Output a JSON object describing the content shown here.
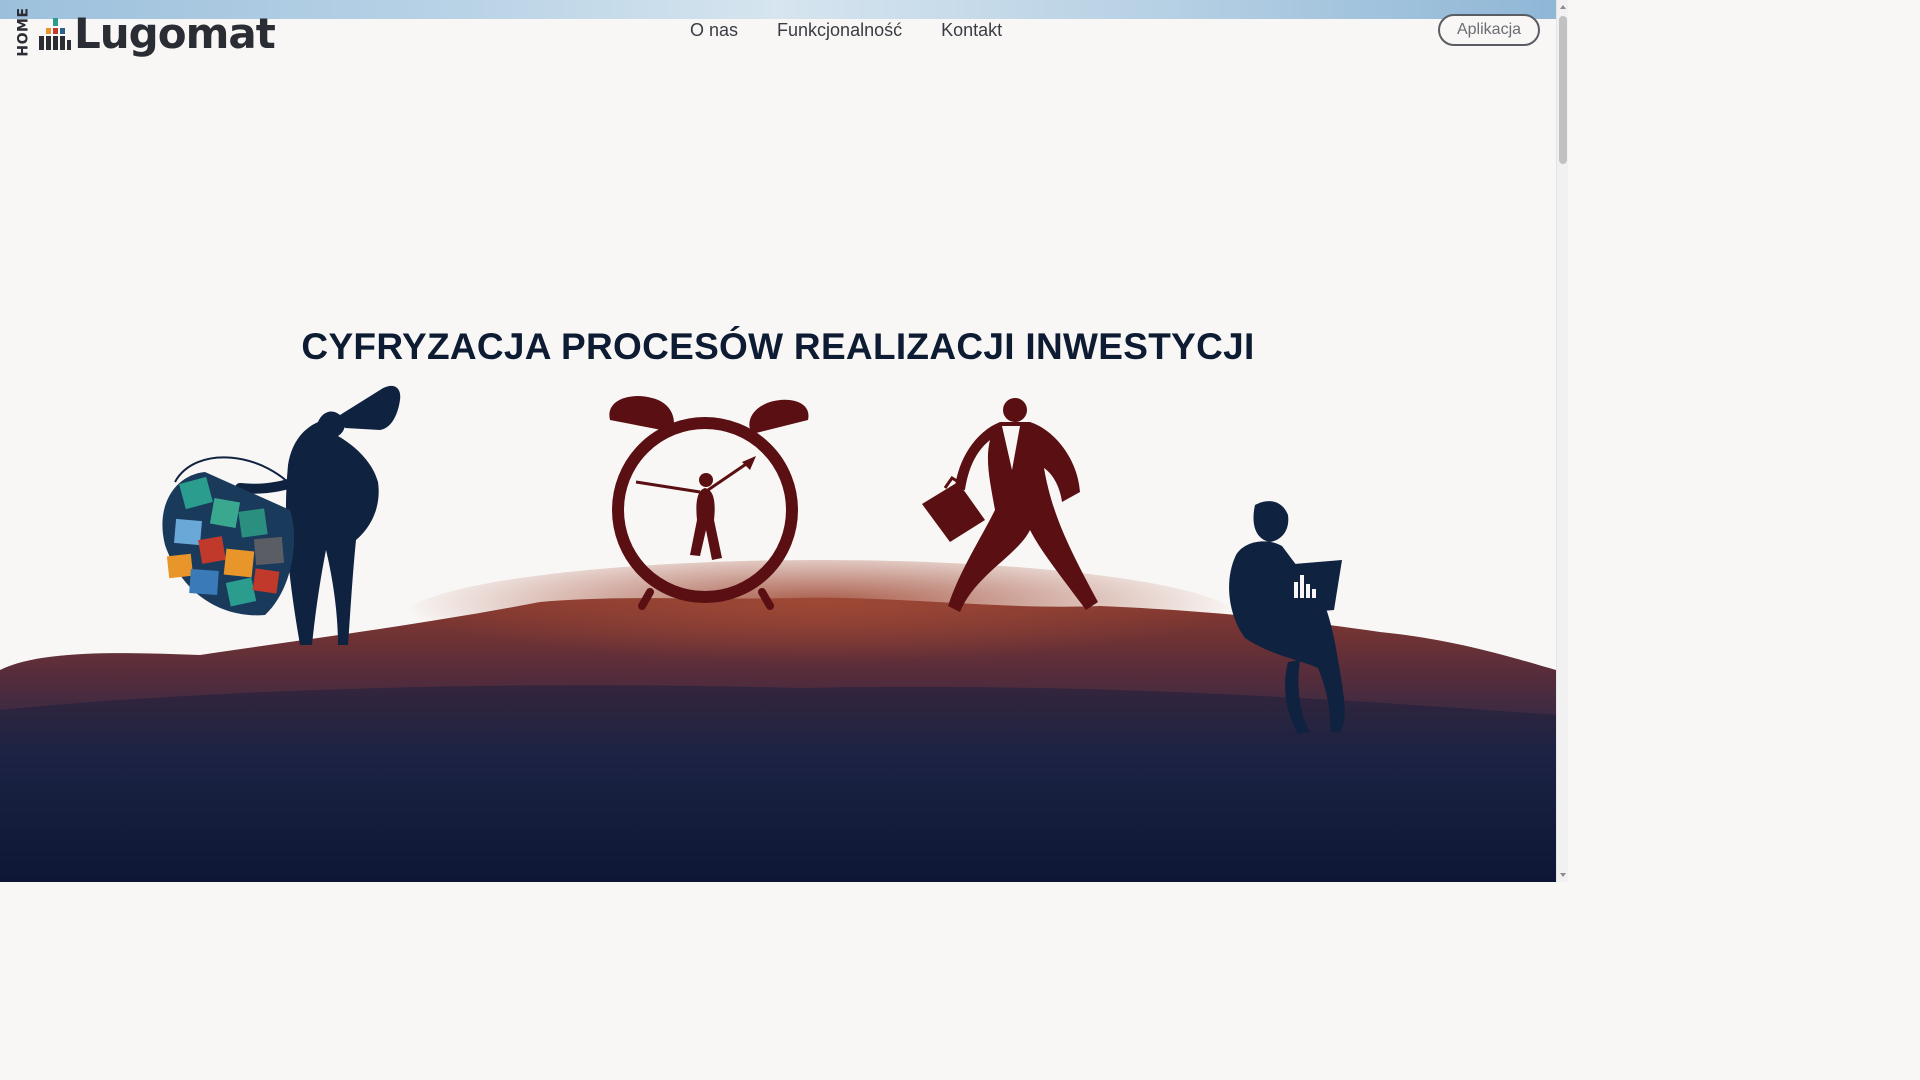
{
  "header": {
    "home_label": "HOME",
    "logo_text": "Lugomat",
    "nav": [
      {
        "label": "O nas"
      },
      {
        "label": "Funkcjonalność"
      },
      {
        "label": "Kontakt"
      }
    ],
    "app_button_label": "Aplikacja"
  },
  "hero": {
    "title": "CYFRYZACJA PROCESÓW REALIZACJI INWESTYCJI"
  },
  "colors": {
    "title": "#0d1b33",
    "figure_navy": "#0f2240",
    "figure_maroon": "#5a0f12",
    "ground_top": "#8a3a2e",
    "ground_bottom": "#0a1230",
    "logo_bar_orange": "#e8962a",
    "logo_bar_teal": "#2a9d8f",
    "logo_bar_red": "#c0392b",
    "logo_bar_blue": "#2c5f8a"
  },
  "scene_icons": [
    "megaphone-icon",
    "icon-bag",
    "alarm-clock-icon",
    "briefcase-icon",
    "laptop-chart-icon"
  ]
}
